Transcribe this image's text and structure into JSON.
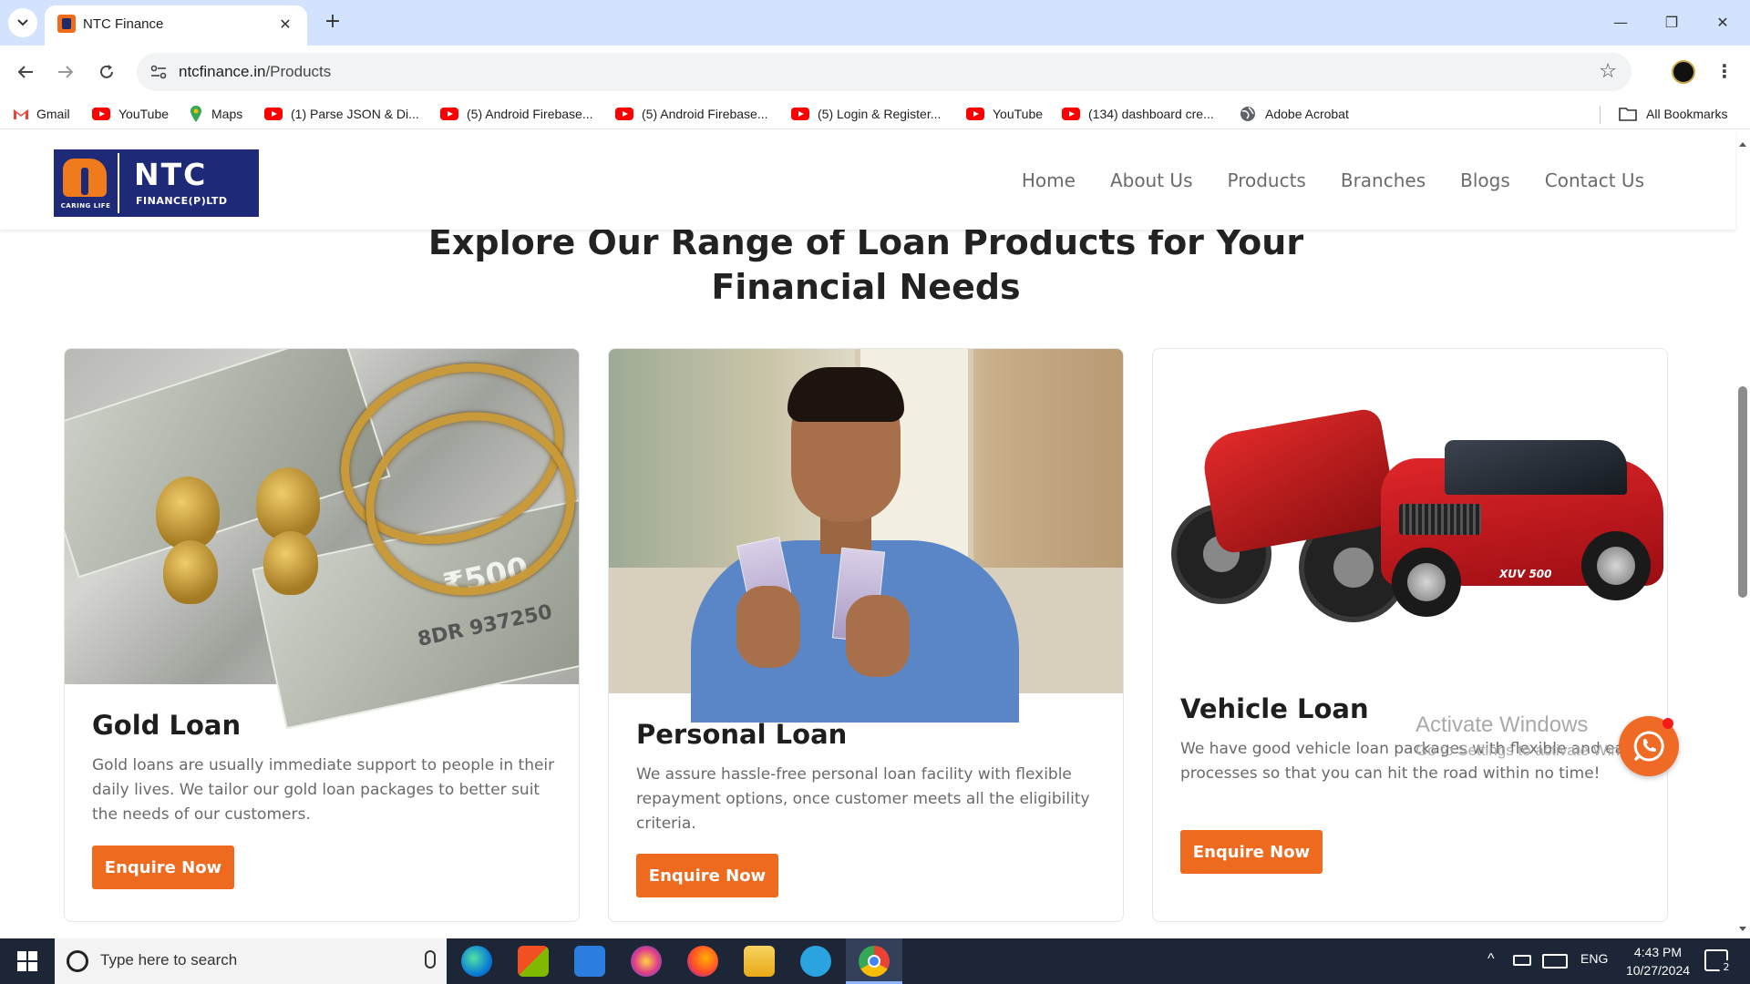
{
  "browser": {
    "tab_title": "NTC Finance",
    "url_host": "ntcfinance.in",
    "url_path": "/Products",
    "new_tab": "+",
    "close": "✕",
    "minimize": "—",
    "restore": "❐",
    "close_window": "✕"
  },
  "bookmarks": [
    {
      "label": "Gmail",
      "icon": "gmail-icon"
    },
    {
      "label": "YouTube",
      "icon": "youtube-icon"
    },
    {
      "label": "Maps",
      "icon": "maps-icon"
    },
    {
      "label": "(1) Parse JSON & Di...",
      "icon": "youtube-icon"
    },
    {
      "label": "(5) Android Firebase...",
      "icon": "youtube-icon"
    },
    {
      "label": "(5) Android Firebase...",
      "icon": "youtube-icon"
    },
    {
      "label": "(5) Login & Register...",
      "icon": "youtube-icon"
    },
    {
      "label": "YouTube",
      "icon": "youtube-icon"
    },
    {
      "label": "(134) dashboard cre...",
      "icon": "youtube-icon"
    },
    {
      "label": "Adobe Acrobat",
      "icon": "globe-icon"
    }
  ],
  "all_bookmarks": "All Bookmarks",
  "site": {
    "logo_name": "NTC",
    "logo_sub": "FINANCE(P)LTD",
    "logo_tag": "CARING LIFE",
    "nav": [
      "Home",
      "About Us",
      "Products",
      "Branches",
      "Blogs",
      "Contact Us"
    ],
    "heading": "Explore Our Range of Loan Products for Your Financial Needs",
    "note_value": "₹500",
    "note_serial": "8DR 937250",
    "vehicle_badge": "XUV 500",
    "products": [
      {
        "title": "Gold Loan",
        "description": "Gold loans are usually immediate support to people in their daily lives. We tailor our gold loan packages to better suit the needs of our customers.",
        "button": "Enquire Now"
      },
      {
        "title": "Personal Loan",
        "description": "We assure hassle-free personal loan facility with flexible repayment options, once customer meets all the eligibility criteria.",
        "button": "Enquire Now"
      },
      {
        "title": "Vehicle Loan",
        "description": "We have good vehicle loan packages with flexible and easy processes so that you can hit the road within no time!",
        "button": "Enquire Now"
      }
    ],
    "brand_colors": {
      "navy": "#1e2a78",
      "orange": "#ee6a1f"
    }
  },
  "watermark": {
    "title": "Activate Windows",
    "subtitle": "Go to Settings to activate Windows."
  },
  "taskbar": {
    "search_placeholder": "Type here to search",
    "language": "ENG",
    "time": "4:43 PM",
    "date": "10/27/2024",
    "notification_count": "2"
  }
}
